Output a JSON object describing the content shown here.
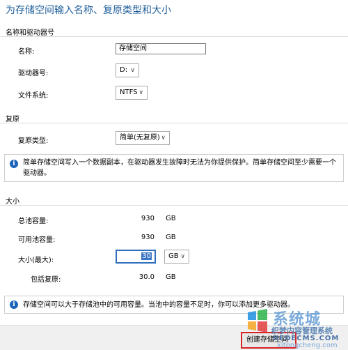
{
  "title": "为存储空间输入名称、复原类型和大小",
  "name_drive": {
    "heading": "名称和驱动器号",
    "name_label": "名称:",
    "name_value": "存储空间",
    "drive_label": "驱动器号:",
    "drive_value": "D:",
    "fs_label": "文件系统:",
    "fs_value": "NTFS"
  },
  "resiliency": {
    "heading": "复原",
    "type_label": "复原类型:",
    "type_value": "简单(无复原)",
    "info": "简单存储空间写入一个数据副本，在驱动器发生故障时无法为你提供保护。简单存储空间至少需要一个驱动器。"
  },
  "size": {
    "heading": "大小",
    "total_label": "总池容量:",
    "total_value": "930",
    "total_unit": "GB",
    "avail_label": "可用池容量:",
    "avail_value": "930",
    "avail_unit": "GB",
    "max_label": "大小(最大):",
    "max_value": "30",
    "max_unit": "GB",
    "incl_label": "包括复原:",
    "incl_value": "30.0",
    "incl_unit": "GB",
    "info": "存储空间可以大于存储池中的可用容量。当池中的容量不足时，你可以添加更多驱动器。"
  },
  "footer": {
    "create_button": "创建存储空间"
  },
  "watermark": {
    "brand": "系统城",
    "line1": "织梦内容管理系统",
    "line2": "DEDECMS.COM",
    "line3": "xitongcheng.com"
  },
  "icons": {
    "info": "info-icon",
    "dropdown": "chevron-down-icon",
    "logo": "windows-logo-icon"
  },
  "colors": {
    "title": "#1f5e9a",
    "info_icon": "#1c64b9",
    "focus_border": "#2f6fbd",
    "button_highlight": "#d72222"
  }
}
